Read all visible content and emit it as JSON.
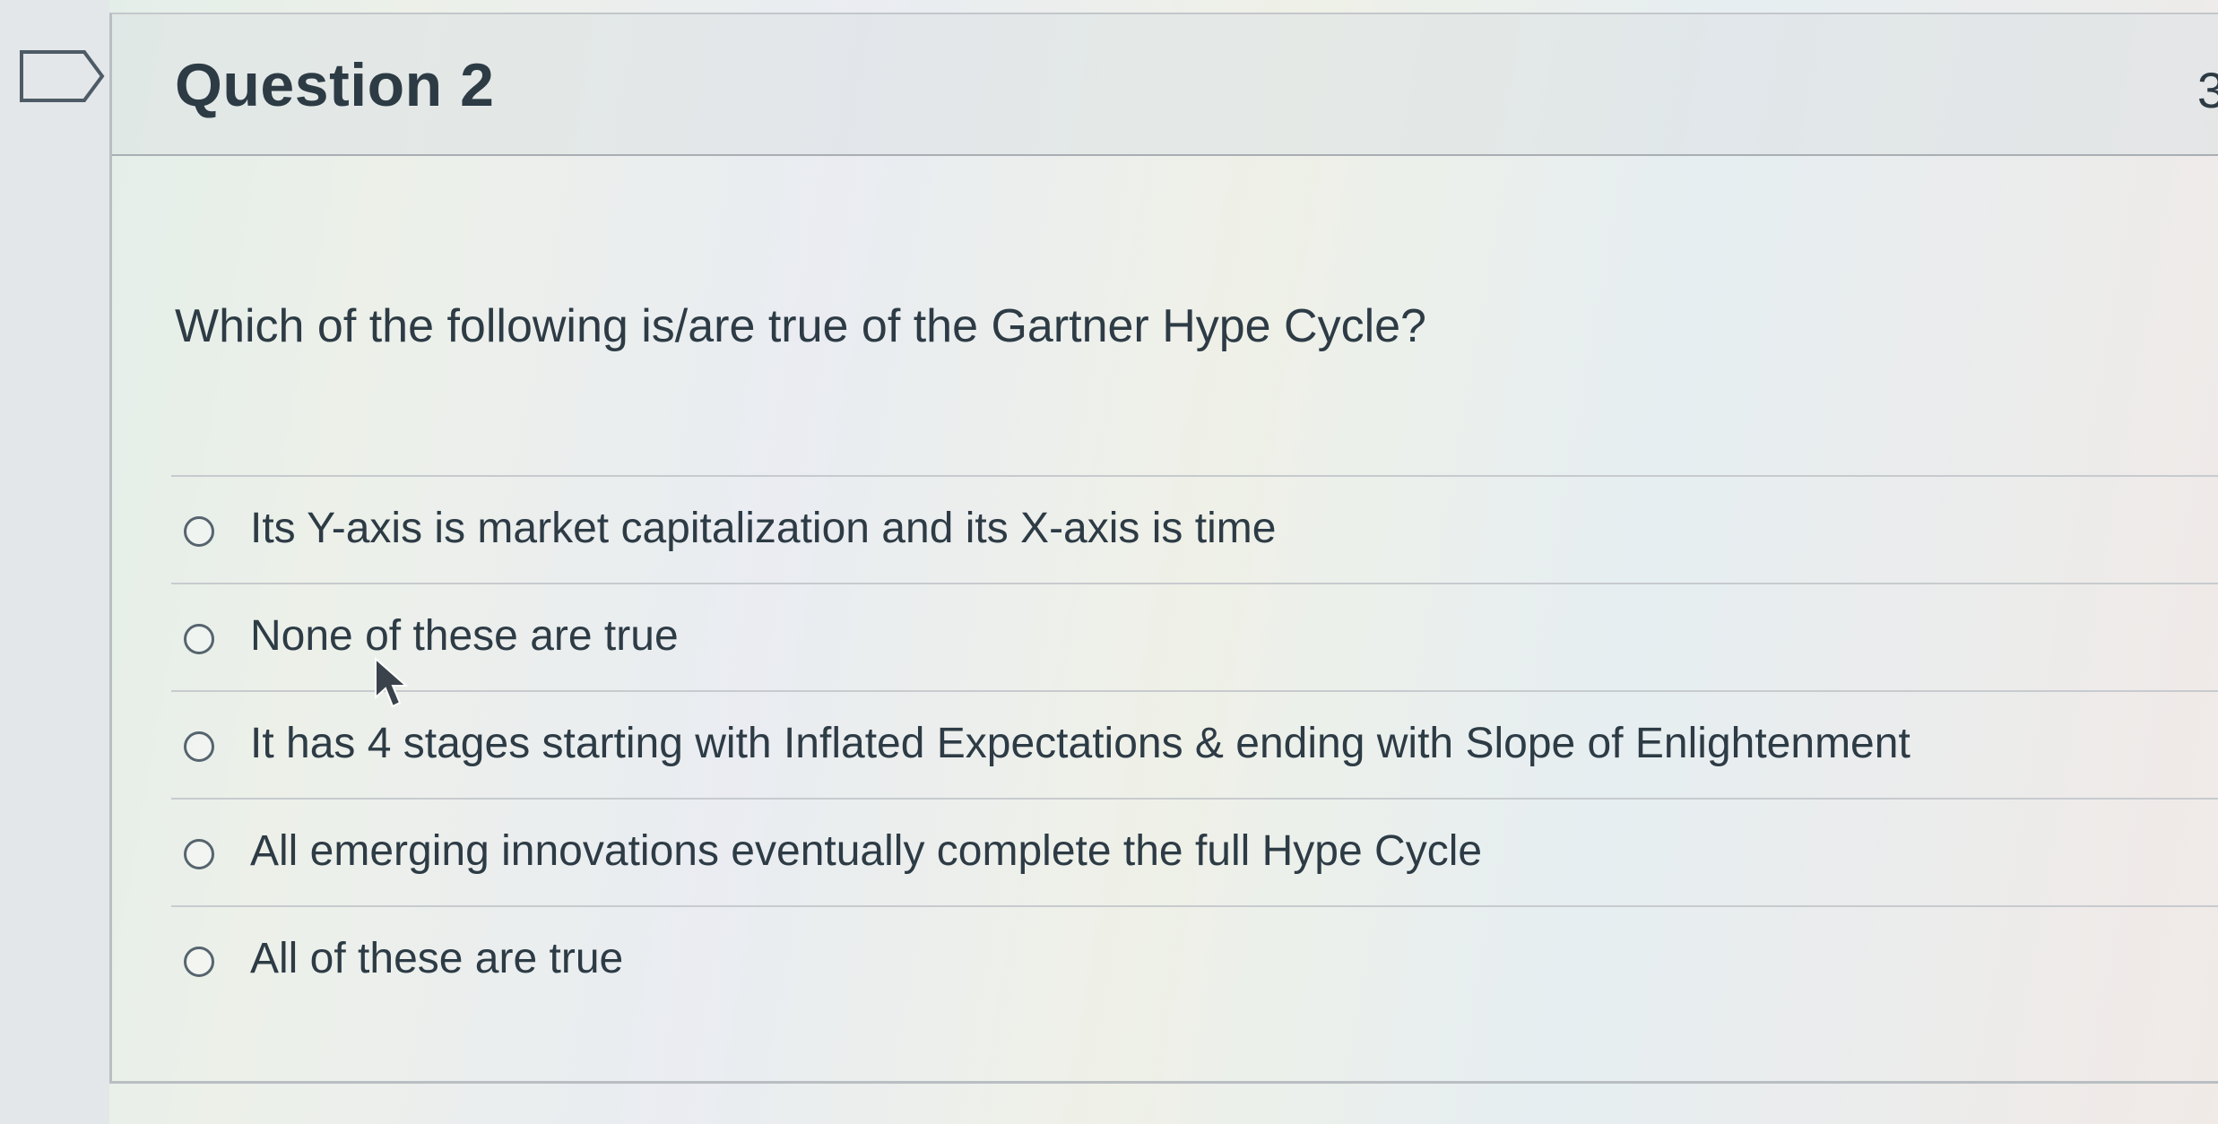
{
  "question": {
    "title": "Question 2",
    "points_partial": "3",
    "prompt": "Which of the following is/are true of the Gartner Hype Cycle?"
  },
  "answers": [
    {
      "label": "Its Y-axis is market capitalization and its X-axis is time",
      "selected": false
    },
    {
      "label": "None of these are true",
      "selected": false
    },
    {
      "label": "It has 4 stages starting with Inflated Expectations & ending with Slope of Enlightenment",
      "selected": false
    },
    {
      "label": "All emerging innovations eventually complete the full Hype Cycle",
      "selected": false
    },
    {
      "label": "All of these are true",
      "selected": false
    }
  ],
  "icons": {
    "flag": "flag-question-icon",
    "cursor": "mouse-pointer-icon"
  },
  "colors": {
    "text": "#2d3b45",
    "radio_border": "#56646e",
    "divider": "#c7cbce"
  }
}
